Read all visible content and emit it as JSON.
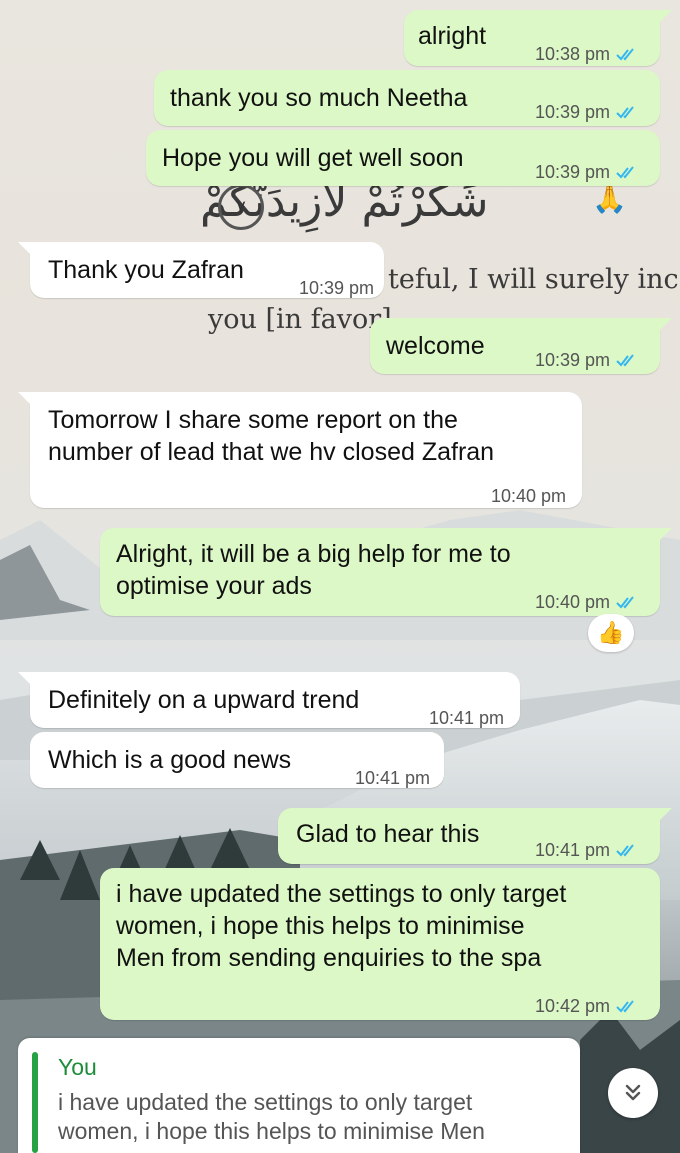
{
  "wallpaper": {
    "arabic_text": "شَكَرْتُمْ لَأَزِيدَنَّكُمْ",
    "verse_number": "٧",
    "english_line1_fragment": "teful, I will surely inc",
    "english_line2_fragment": "you [in favor]"
  },
  "messages": [
    {
      "dir": "out",
      "text": "alright",
      "time": "10:38 pm",
      "read": true
    },
    {
      "dir": "out",
      "text": "thank you so much Neetha",
      "time": "10:39 pm",
      "read": true
    },
    {
      "dir": "out",
      "text": "Hope you will get well soon",
      "time": "10:39 pm",
      "read": true
    },
    {
      "dir": "in",
      "text": "Thank you Zafran",
      "time": "10:39 pm"
    },
    {
      "dir": "out",
      "text": "welcome",
      "time": "10:39 pm",
      "read": true
    },
    {
      "dir": "in",
      "text": "Tomorrow I share some report on the\nnumber of lead that we hv closed Zafran",
      "time": "10:40 pm"
    },
    {
      "dir": "out",
      "text": "Alright, it will be a big help for me to\noptimise your ads",
      "time": "10:40 pm",
      "read": true,
      "reaction": "👍"
    },
    {
      "dir": "in",
      "text": "Definitely on a upward trend",
      "time": "10:41 pm"
    },
    {
      "dir": "in",
      "text": "Which is a good news",
      "time": "10:41 pm"
    },
    {
      "dir": "out",
      "text": "Glad to hear this",
      "time": "10:41 pm",
      "read": true
    },
    {
      "dir": "out",
      "text": "i have updated the settings to only target\nwomen, i hope this helps to minimise\nMen from sending enquiries to the spa",
      "time": "10:42 pm",
      "read": true
    }
  ],
  "reply_preview": {
    "author": "You",
    "text": "i have updated the settings to only target women, i hope this helps to minimise Men"
  },
  "icons": {
    "read_receipt": "double-check-icon",
    "scroll_down": "double-chevron-down-icon",
    "pray_emoji": "🙏"
  },
  "colors": {
    "outgoing_bubble": "#dcf8c6",
    "incoming_bubble": "#ffffff",
    "read_tick": "#34b7f1",
    "reply_accent": "#25a244"
  }
}
